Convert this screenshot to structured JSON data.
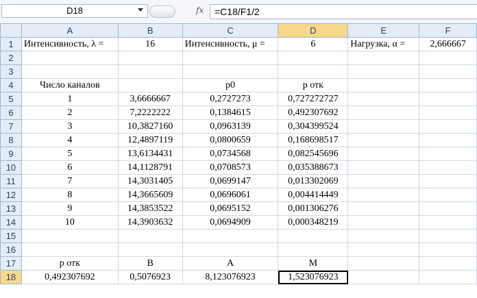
{
  "formula_bar": {
    "name_box": "D18",
    "fx_label": "fx",
    "formula": "=C18/F1/2"
  },
  "columns": [
    "A",
    "B",
    "C",
    "D",
    "E",
    "F"
  ],
  "rows": [
    {
      "n": "1",
      "cells": [
        "Интенсивность, λ =",
        "16",
        "Интенсивность, μ =",
        "6",
        "Нагрузка, α =",
        "2,666667"
      ]
    },
    {
      "n": "2",
      "cells": [
        "",
        "",
        "",
        "",
        "",
        ""
      ]
    },
    {
      "n": "3",
      "cells": [
        "",
        "",
        "",
        "",
        "",
        ""
      ]
    },
    {
      "n": "4",
      "cells": [
        "Число каналов",
        "",
        "p0",
        "p отк",
        "",
        ""
      ]
    },
    {
      "n": "5",
      "cells": [
        "1",
        "3,6666667",
        "0,2727273",
        "0,727272727",
        "",
        ""
      ]
    },
    {
      "n": "6",
      "cells": [
        "2",
        "7,2222222",
        "0,1384615",
        "0,492307692",
        "",
        ""
      ]
    },
    {
      "n": "7",
      "cells": [
        "3",
        "10,3827160",
        "0,0963139",
        "0,304399524",
        "",
        ""
      ]
    },
    {
      "n": "8",
      "cells": [
        "4",
        "12,4897119",
        "0,0800659",
        "0,168698517",
        "",
        ""
      ]
    },
    {
      "n": "9",
      "cells": [
        "5",
        "13,6134431",
        "0,0734568",
        "0,082545696",
        "",
        ""
      ]
    },
    {
      "n": "10",
      "cells": [
        "6",
        "14,1128791",
        "0,0708573",
        "0,035388673",
        "",
        ""
      ]
    },
    {
      "n": "11",
      "cells": [
        "7",
        "14,3031405",
        "0,0699147",
        "0,013302069",
        "",
        ""
      ]
    },
    {
      "n": "12",
      "cells": [
        "8",
        "14,3665609",
        "0,0696061",
        "0,004414449",
        "",
        ""
      ]
    },
    {
      "n": "13",
      "cells": [
        "9",
        "14,3853522",
        "0,0695152",
        "0,001306276",
        "",
        ""
      ]
    },
    {
      "n": "14",
      "cells": [
        "10",
        "14,3903632",
        "0,0694909",
        "0,000348219",
        "",
        ""
      ]
    },
    {
      "n": "15",
      "cells": [
        "",
        "",
        "",
        "",
        "",
        ""
      ]
    },
    {
      "n": "16",
      "cells": [
        "",
        "",
        "",
        "",
        "",
        ""
      ]
    },
    {
      "n": "17",
      "cells": [
        "p отк",
        "B",
        "A",
        "M",
        "",
        ""
      ]
    },
    {
      "n": "18",
      "cells": [
        "0,492307692",
        "0,5076923",
        "8,123076923",
        "1,523076923",
        "",
        ""
      ]
    }
  ]
}
